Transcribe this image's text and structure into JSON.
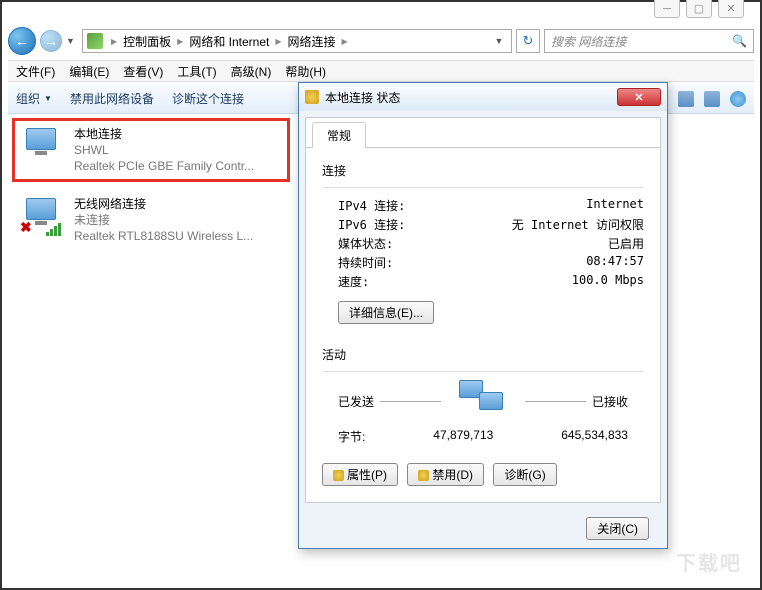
{
  "breadcrumb": {
    "root_icon": "control-panel-icon",
    "items": [
      "控制面板",
      "网络和 Internet",
      "网络连接"
    ]
  },
  "search": {
    "placeholder": "搜索 网络连接"
  },
  "menubar": [
    "文件(F)",
    "编辑(E)",
    "查看(V)",
    "工具(T)",
    "高级(N)",
    "帮助(H)"
  ],
  "toolbar": {
    "organize": "组织",
    "disable": "禁用此网络设备",
    "diagnose": "诊断这个连接"
  },
  "connections": [
    {
      "name": "本地连接",
      "status": "SHWL",
      "device": "Realtek PCIe GBE Family Contr..."
    },
    {
      "name": "无线网络连接",
      "status": "未连接",
      "device": "Realtek RTL8188SU Wireless L..."
    }
  ],
  "dialog": {
    "title": "本地连接 状态",
    "tab": "常规",
    "section_conn": "连接",
    "rows": [
      {
        "k": "IPv4 连接:",
        "v": "Internet"
      },
      {
        "k": "IPv6 连接:",
        "v": "无 Internet 访问权限"
      },
      {
        "k": "媒体状态:",
        "v": "已启用"
      },
      {
        "k": "持续时间:",
        "v": "08:47:57"
      },
      {
        "k": "速度:",
        "v": "100.0 Mbps"
      }
    ],
    "details_btn": "详细信息(E)...",
    "section_act": "活动",
    "sent_label": "已发送",
    "recv_label": "已接收",
    "bytes_label": "字节:",
    "sent_bytes": "47,879,713",
    "recv_bytes": "645,534,833",
    "btn_props": "属性(P)",
    "btn_disable": "禁用(D)",
    "btn_diag": "诊断(G)",
    "btn_close": "关闭(C)"
  },
  "watermark": "下载吧"
}
